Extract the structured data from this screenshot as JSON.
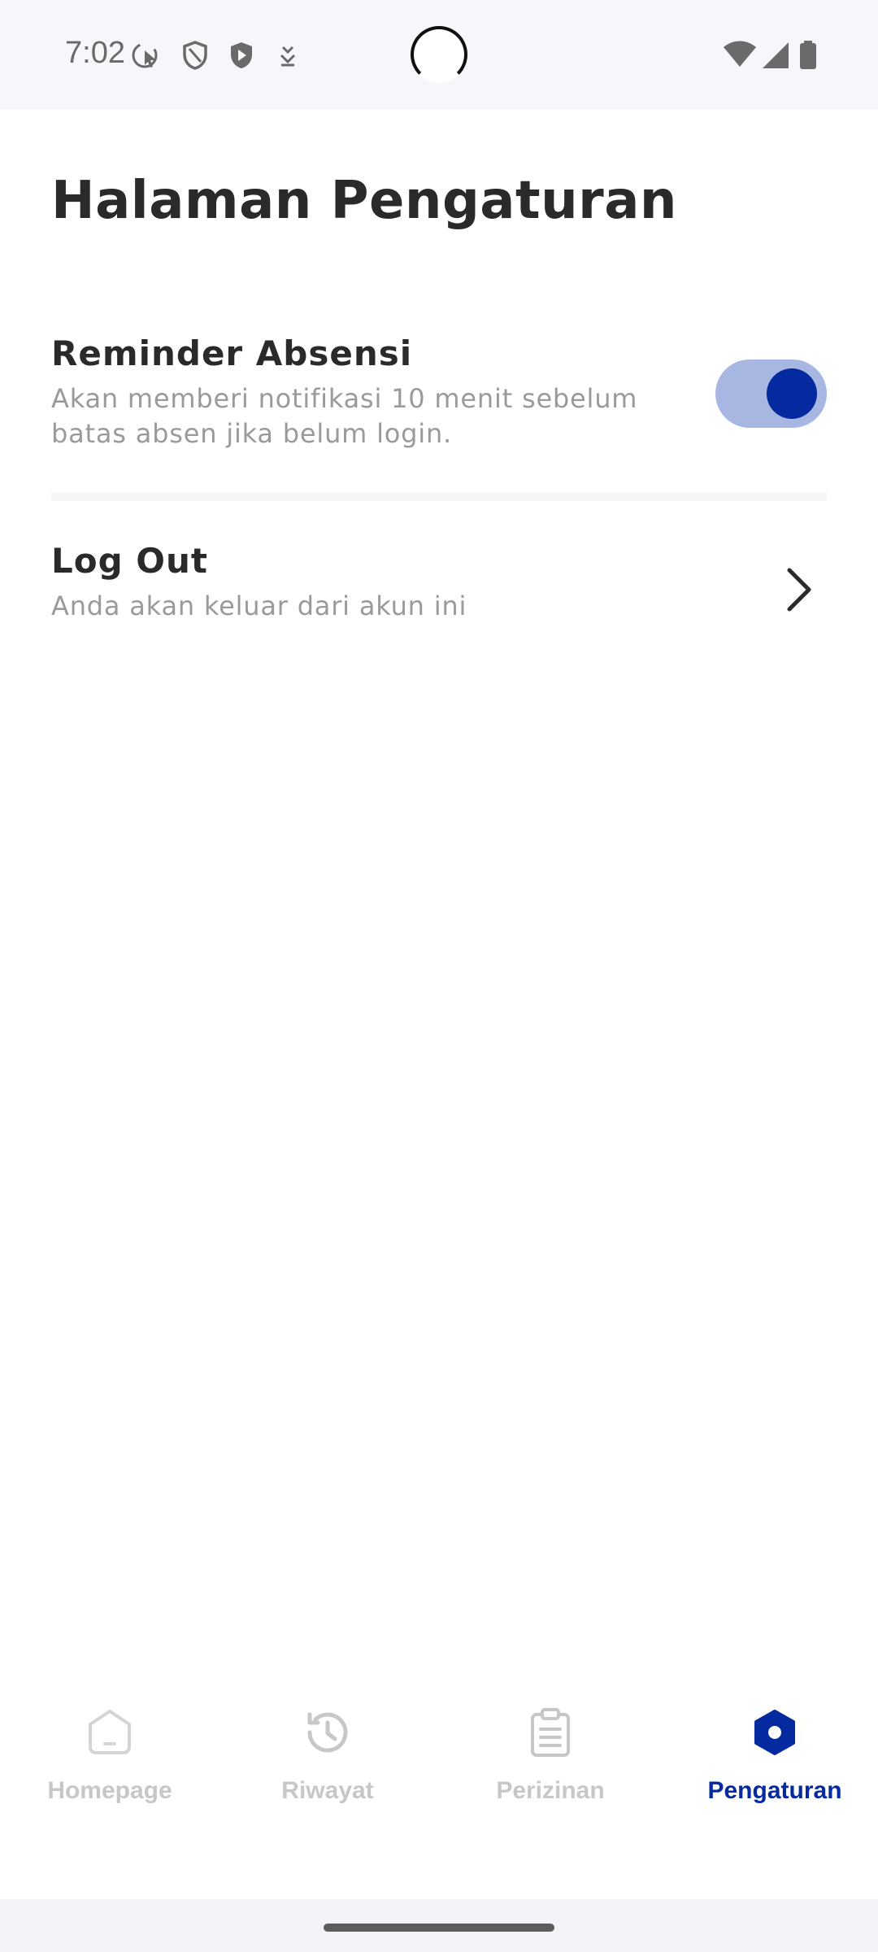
{
  "status_bar": {
    "time": "7:02",
    "left_icons": [
      "screen-record-icon",
      "shield-outline-icon",
      "shield-play-icon",
      "download-arrow-icon"
    ],
    "right_icons": [
      "wifi-icon",
      "cellular-signal-icon",
      "battery-icon"
    ]
  },
  "page": {
    "title": "Halaman Pengaturan"
  },
  "settings": {
    "reminder": {
      "title": "Reminder Absensi",
      "description": "Akan memberi notifikasi 10 menit sebelum batas absen jika belum login.",
      "enabled": true
    },
    "logout": {
      "title": "Log Out",
      "description": "Anda akan keluar dari akun ini",
      "icon": "chevron-right-icon"
    }
  },
  "bottom_nav": {
    "items": [
      {
        "label": "Homepage",
        "icon": "home-icon",
        "active": false
      },
      {
        "label": "Riwayat",
        "icon": "history-icon",
        "active": false
      },
      {
        "label": "Perizinan",
        "icon": "clipboard-icon",
        "active": false
      },
      {
        "label": "Pengaturan",
        "icon": "settings-hexagon-icon",
        "active": true
      }
    ]
  },
  "colors": {
    "accent": "#05299e",
    "toggle_track": "#a8b6e2",
    "inactive": "#c7c7c7",
    "text_primary": "#2a2a2a",
    "text_secondary": "#9a9a9a"
  }
}
